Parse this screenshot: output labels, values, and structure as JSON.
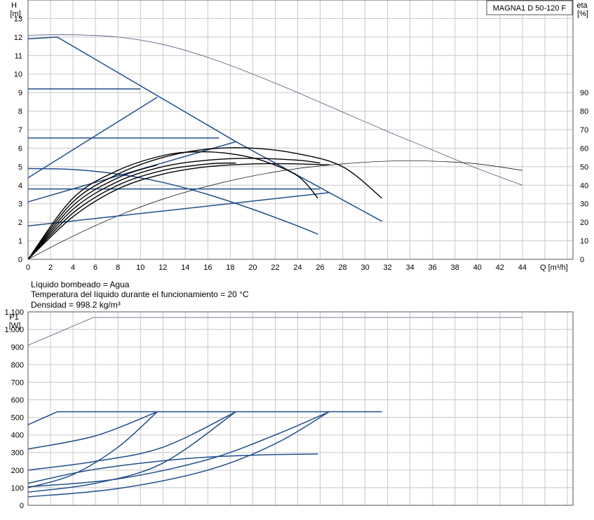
{
  "chart_data": [
    {
      "type": "line",
      "title": "MAGNA1 D 50-120 F",
      "xlabel": "Q [m³/h]",
      "ylabel": "H",
      "ylabel_unit": "[m]",
      "y2label": "eta",
      "y2label_unit": "[%]",
      "xlim": [
        0,
        48.5
      ],
      "ylim": [
        0,
        14
      ],
      "y2lim": [
        0,
        140
      ],
      "xticks": [
        0,
        2,
        4,
        6,
        8,
        10,
        12,
        14,
        16,
        18,
        20,
        22,
        24,
        26,
        28,
        30,
        32,
        34,
        36,
        38,
        40,
        42,
        44
      ],
      "yticks": [
        0,
        1,
        2,
        3,
        4,
        5,
        6,
        7,
        8,
        9,
        10,
        11,
        12,
        13
      ],
      "y2ticks": [
        0,
        10,
        20,
        30,
        40,
        50,
        60,
        70,
        80,
        90
      ],
      "grid": true,
      "series": [
        {
          "role": "head-max-single",
          "color": "#4a5a78",
          "width": 0.8,
          "points": [
            [
              0,
              12.1
            ],
            [
              4,
              12.12
            ],
            [
              8,
              12.0
            ],
            [
              12,
              11.6
            ],
            [
              16,
              10.9
            ],
            [
              20,
              10.0
            ],
            [
              24,
              9.0
            ],
            [
              28,
              7.95
            ],
            [
              32,
              6.9
            ],
            [
              36,
              5.9
            ],
            [
              40,
              4.9
            ],
            [
              44,
              4.0
            ]
          ]
        },
        {
          "role": "eta-max-single",
          "axis": "y2",
          "color": "#000000",
          "width": 0.7,
          "points": [
            [
              0,
              0
            ],
            [
              4,
              12.5
            ],
            [
              8,
              23.5
            ],
            [
              12,
              32.5
            ],
            [
              16,
              39.5
            ],
            [
              20,
              45
            ],
            [
              24,
              49
            ],
            [
              28,
              51.5
            ],
            [
              32,
              53
            ],
            [
              36,
              53
            ],
            [
              40,
              51.5
            ],
            [
              44,
              48
            ]
          ]
        },
        {
          "role": "head-max",
          "color": "#1f4e8c",
          "width": 1.5,
          "points": [
            [
              0,
              11.9
            ],
            [
              2.6,
              12.0
            ],
            [
              18.5,
              6.35
            ],
            [
              31.5,
              2.05
            ]
          ]
        },
        {
          "role": "cp-high",
          "color": "#1f4e8c",
          "width": 1.5,
          "points": [
            [
              0,
              9.2
            ],
            [
              10,
              9.2
            ]
          ]
        },
        {
          "role": "cp-mid",
          "color": "#1f4e8c",
          "width": 1.5,
          "points": [
            [
              0,
              6.55
            ],
            [
              17,
              6.55
            ]
          ]
        },
        {
          "role": "cp-low",
          "color": "#1f4e8c",
          "width": 1.5,
          "points": [
            [
              0,
              3.8
            ],
            [
              26,
              3.8
            ]
          ]
        },
        {
          "role": "pp-high",
          "color": "#1f4e8c",
          "width": 1.5,
          "points": [
            [
              0,
              4.4
            ],
            [
              11.5,
              8.75
            ]
          ]
        },
        {
          "role": "pp-mid",
          "color": "#1f4e8c",
          "width": 1.5,
          "points": [
            [
              0,
              3.1
            ],
            [
              18.5,
              6.35
            ]
          ]
        },
        {
          "role": "pp-low",
          "color": "#1f4e8c",
          "width": 1.5,
          "points": [
            [
              0,
              1.8
            ],
            [
              26.8,
              3.6
            ]
          ]
        },
        {
          "role": "head-min",
          "color": "#1f4e8c",
          "width": 1.5,
          "points": [
            [
              0,
              4.9
            ],
            [
              4,
              4.85
            ],
            [
              8,
              4.6
            ],
            [
              12,
              4.15
            ],
            [
              16,
              3.5
            ],
            [
              20,
              2.7
            ],
            [
              24,
              1.8
            ],
            [
              25.8,
              1.35
            ]
          ]
        },
        {
          "role": "eta-1",
          "axis": "y2",
          "color": "#000000",
          "width": 1.4,
          "points": [
            [
              0,
              0
            ],
            [
              4,
              31
            ],
            [
              8,
              46
            ],
            [
              12,
              55
            ],
            [
              16,
              59.5
            ],
            [
              20,
              60
            ],
            [
              24,
              57
            ],
            [
              28,
              50
            ],
            [
              31.5,
              33
            ]
          ]
        },
        {
          "role": "eta-2",
          "axis": "y2",
          "color": "#000000",
          "width": 1.4,
          "points": [
            [
              0,
              0
            ],
            [
              4,
              33
            ],
            [
              8,
              48
            ],
            [
              12,
              56
            ],
            [
              15,
              58
            ],
            [
              18,
              57
            ],
            [
              21,
              53
            ],
            [
              24,
              45
            ],
            [
              25.8,
              33
            ]
          ]
        },
        {
          "role": "eta-3",
          "axis": "y2",
          "color": "#000000",
          "width": 1.4,
          "points": [
            [
              0,
              0
            ],
            [
              4,
              27
            ],
            [
              8,
              42
            ],
            [
              12,
              50
            ],
            [
              16,
              53.5
            ],
            [
              20,
              54.5
            ],
            [
              24,
              53.5
            ],
            [
              26,
              52
            ]
          ]
        },
        {
          "role": "eta-4",
          "axis": "y2",
          "color": "#000000",
          "width": 1.4,
          "points": [
            [
              0,
              0
            ],
            [
              4,
              23
            ],
            [
              8,
              38
            ],
            [
              12,
              46
            ],
            [
              16,
              50
            ],
            [
              20,
              51.5
            ],
            [
              24,
              51.5
            ],
            [
              26.8,
              51
            ]
          ]
        },
        {
          "role": "eta-5",
          "axis": "y2",
          "color": "#000000",
          "width": 1.4,
          "points": [
            [
              0,
              0
            ],
            [
              4,
              29
            ],
            [
              8,
              44
            ],
            [
              11.5,
              51
            ]
          ]
        },
        {
          "role": "eta-6",
          "axis": "y2",
          "color": "#000000",
          "width": 1.4,
          "points": [
            [
              0,
              0
            ],
            [
              4,
              25
            ],
            [
              8,
              40
            ],
            [
              12,
              48
            ],
            [
              16,
              51.5
            ],
            [
              18.5,
              52
            ]
          ]
        }
      ]
    },
    {
      "type": "line",
      "ylabel": "P1",
      "ylabel_unit": "[W]",
      "xlim": [
        0,
        48.5
      ],
      "ylim": [
        0,
        1100
      ],
      "yticks": [
        0,
        100,
        200,
        300,
        400,
        500,
        600,
        700,
        800,
        900,
        1000,
        1100
      ],
      "ytick_labels": [
        "0",
        "100",
        "200",
        "300",
        "400",
        "500",
        "600",
        "700",
        "800",
        "900",
        "1.000",
        "1.100"
      ],
      "grid": true,
      "series": [
        {
          "role": "p1-max-single",
          "color": "#4a5a78",
          "width": 0.8,
          "points": [
            [
              0,
              910
            ],
            [
              5.8,
              1068
            ],
            [
              44,
              1068
            ]
          ]
        },
        {
          "role": "p1-max",
          "color": "#1f4e8c",
          "width": 1.5,
          "points": [
            [
              0,
              458
            ],
            [
              2.6,
              532
            ],
            [
              31.5,
              532
            ]
          ]
        },
        {
          "role": "p1-cp-high",
          "color": "#1f4e8c",
          "width": 1.5,
          "points": [
            [
              0,
              320
            ],
            [
              6,
              395
            ],
            [
              11.5,
              532
            ]
          ]
        },
        {
          "role": "p1-pp-high",
          "color": "#1f4e8c",
          "width": 1.5,
          "points": [
            [
              0,
              100
            ],
            [
              4,
              175
            ],
            [
              8,
              330
            ],
            [
              11.5,
              532
            ]
          ]
        },
        {
          "role": "p1-cp-mid",
          "color": "#1f4e8c",
          "width": 1.5,
          "points": [
            [
              0,
              200
            ],
            [
              6,
              250
            ],
            [
              12,
              330
            ],
            [
              18.5,
              532
            ]
          ]
        },
        {
          "role": "p1-pp-mid",
          "color": "#1f4e8c",
          "width": 1.5,
          "points": [
            [
              0,
              75
            ],
            [
              6,
              125
            ],
            [
              12,
              240
            ],
            [
              18.5,
              532
            ]
          ]
        },
        {
          "role": "p1-cp-low",
          "color": "#1f4e8c",
          "width": 1.5,
          "points": [
            [
              0,
              105
            ],
            [
              8,
              150
            ],
            [
              16,
              260
            ],
            [
              22,
              400
            ],
            [
              26.8,
              532
            ]
          ]
        },
        {
          "role": "p1-pp-low",
          "color": "#1f4e8c",
          "width": 1.5,
          "points": [
            [
              0,
              48
            ],
            [
              8,
              95
            ],
            [
              16,
              200
            ],
            [
              22,
              350
            ],
            [
              26.8,
              532
            ]
          ]
        },
        {
          "role": "p1-min",
          "color": "#1f4e8c",
          "width": 1.5,
          "points": [
            [
              0,
              125
            ],
            [
              6,
              205
            ],
            [
              14,
              265
            ],
            [
              20,
              285
            ],
            [
              25.8,
              292
            ]
          ]
        }
      ]
    }
  ],
  "info": {
    "line1": "Líquido bombeado = Agua",
    "line2": "Temperatura del líquido durante el funcionamiento = 20 °C",
    "line3": "Densidad = 998.2 kg/m³"
  }
}
